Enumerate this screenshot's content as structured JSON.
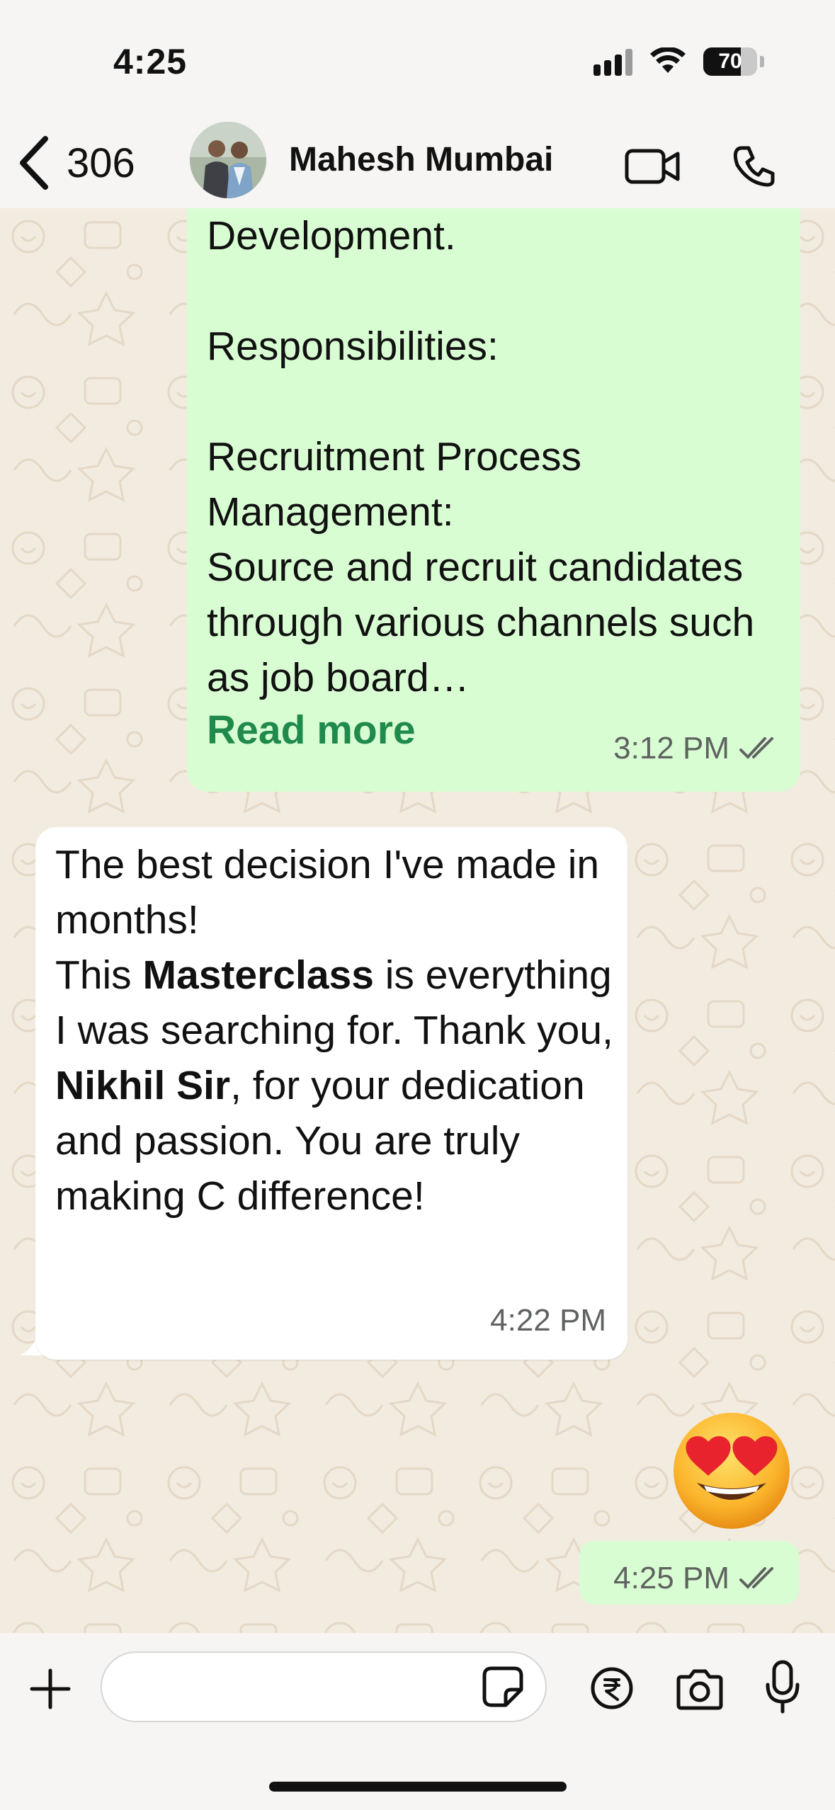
{
  "status_bar": {
    "time": "4:25",
    "battery_percent": 70,
    "battery_label": "70"
  },
  "header": {
    "back_count": "306",
    "contact_name": "Mahesh Mumbai",
    "icons": [
      "back-chevron-icon",
      "video-call-icon",
      "phone-call-icon"
    ]
  },
  "messages": {
    "m1": {
      "text": "Development.\n\nResponsibilities:\n\nRecruitment Process Management:\nSource and recruit candidates through various channels such as job board…",
      "read_more": "Read more",
      "time": "3:12 PM",
      "status": "read"
    },
    "m2": {
      "p1": "The best decision I've made in months!",
      "p2_prefix": "This ",
      "p2_bold": "Masterclass",
      "p2_suffix": " is everything I was searching for. Thank you, ",
      "p2_bold2": "Nikhil Sir",
      "p2_end": ", for your dedication and passion. You are truly making C difference!",
      "time": "4:22 PM"
    },
    "m3": {
      "emoji": "smiling-face-with-heart-eyes",
      "time": "4:25 PM",
      "status": "read"
    }
  },
  "composer": {
    "placeholder": "",
    "icons": [
      "plus-icon",
      "sticker-icon",
      "rupee-payment-icon",
      "camera-icon",
      "microphone-icon"
    ]
  },
  "colors": {
    "outgoing_bubble": "#d9fdd3",
    "incoming_bubble": "#ffffff",
    "read_more": "#1f8a4c",
    "wallpaper": "#f2ebe0"
  }
}
